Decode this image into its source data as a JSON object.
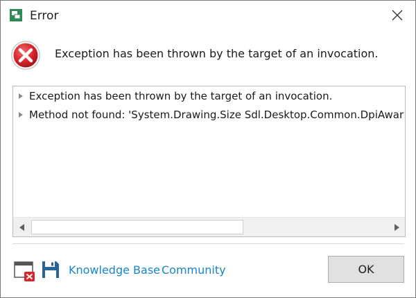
{
  "window": {
    "title": "Error",
    "icons": {
      "app": "app-window-icon",
      "close": "close-icon"
    }
  },
  "message": {
    "icon": "error-icon",
    "text": "Exception has been thrown by the target of an invocation."
  },
  "details": {
    "rows": [
      {
        "label": "Exception has been thrown by the target of an invocation.",
        "icon": "expand-arrow-icon"
      },
      {
        "label": "Method not found: 'System.Drawing.Size Sdl.Desktop.Common.DpiAwar",
        "icon": "expand-arrow-icon"
      }
    ],
    "scrollbar": {
      "left_icon": "scroll-left-icon",
      "right_icon": "scroll-right-icon"
    }
  },
  "footer": {
    "icons": [
      "clear-log-icon",
      "save-icon"
    ],
    "links": {
      "knowledge_base": "Knowledge Base",
      "community": "Community"
    },
    "ok_label": "OK"
  },
  "colors": {
    "link": "#1a84c7",
    "error_red": "#d9262b",
    "button_bg": "#e1e1e1"
  }
}
